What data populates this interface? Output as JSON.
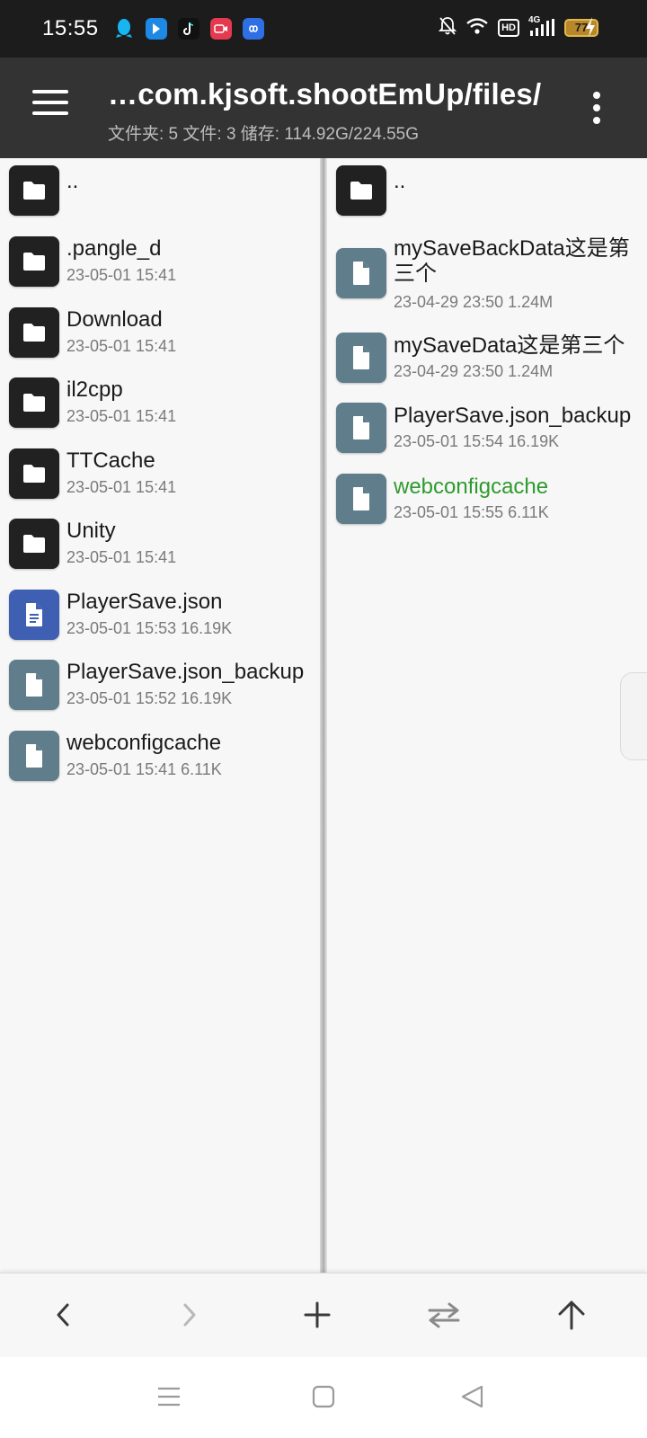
{
  "status_bar": {
    "time": "15:55",
    "battery": "77",
    "hd_badge": "HD",
    "network": "4G",
    "app_icons": [
      "qq-icon",
      "bilibili-icon",
      "tiktok-icon",
      "video-record-icon",
      "baidu-netdisk-icon"
    ]
  },
  "app_bar": {
    "title": "…com.kjsoft.shootEmUp/files/",
    "subtitle": "文件夹: 5  文件: 3  储存: 114.92G/224.55G"
  },
  "left_pane": {
    "items": [
      {
        "name": "..",
        "meta": "",
        "type": "folder"
      },
      {
        "name": ".pangle_d",
        "meta": "23-05-01 15:41",
        "type": "folder"
      },
      {
        "name": "Download",
        "meta": "23-05-01 15:41",
        "type": "folder"
      },
      {
        "name": "il2cpp",
        "meta": "23-05-01 15:41",
        "type": "folder"
      },
      {
        "name": "TTCache",
        "meta": "23-05-01 15:41",
        "type": "folder"
      },
      {
        "name": "Unity",
        "meta": "23-05-01 15:41",
        "type": "folder"
      },
      {
        "name": "PlayerSave.json",
        "meta": "23-05-01 15:53  16.19K",
        "type": "json"
      },
      {
        "name": "PlayerSave.json_backup",
        "meta": "23-05-01 15:52  16.19K",
        "type": "doc"
      },
      {
        "name": "webconfigcache",
        "meta": "23-05-01 15:41  6.11K",
        "type": "doc"
      }
    ]
  },
  "right_pane": {
    "items": [
      {
        "name": "..",
        "meta": "",
        "type": "folder"
      },
      {
        "name": "mySaveBackData这是第三个",
        "meta": "23-04-29 23:50  1.24M",
        "type": "doc"
      },
      {
        "name": "mySaveData这是第三个",
        "meta": "23-04-29 23:50  1.24M",
        "type": "doc"
      },
      {
        "name": "PlayerSave.json_backup",
        "meta": "23-05-01 15:54  16.19K",
        "type": "doc"
      },
      {
        "name": "webconfigcache",
        "meta": "23-05-01 15:55  6.11K",
        "type": "doc",
        "highlight": "#2e9a2e"
      }
    ]
  },
  "toolbar": {
    "buttons": [
      "back-arrow-icon",
      "forward-arrow-icon",
      "add-icon",
      "swap-panes-icon",
      "parent-directory-icon"
    ]
  },
  "nav_bar": {
    "buttons": [
      "recents-icon",
      "home-icon",
      "back-triangle-icon"
    ]
  }
}
